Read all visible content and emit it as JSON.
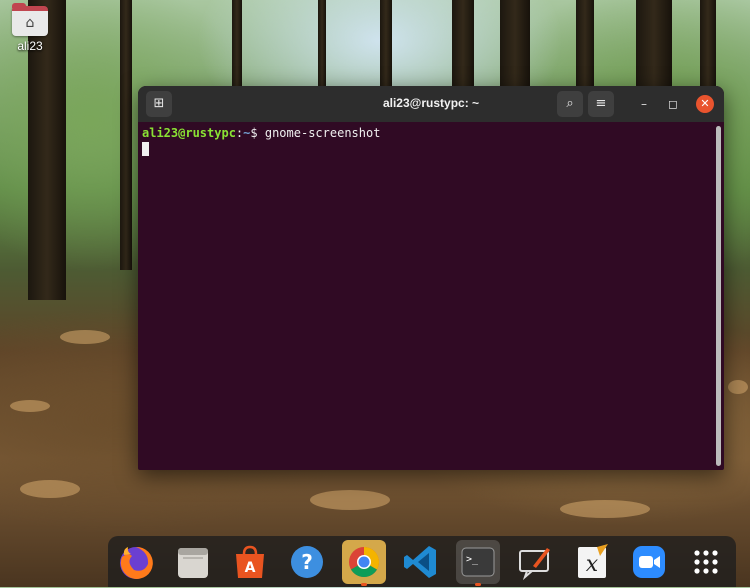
{
  "desktop": {
    "icons": [
      {
        "label": "ali23",
        "glyph": "⌂",
        "icon": "home-folder-icon"
      }
    ]
  },
  "terminal": {
    "title": "ali23@rustypc: ~",
    "buttons": {
      "new_tab_glyph": "⊞",
      "search_glyph": "⌕",
      "menu_glyph": "≡",
      "minimize_glyph": "–",
      "maximize_glyph": "◻",
      "close_glyph": "✕"
    },
    "prompt_user_host": "ali23@rustypc",
    "prompt_sep": ":",
    "prompt_path": "~",
    "prompt_symbol": "$",
    "command": "gnome-screenshot"
  },
  "dock": {
    "apps": [
      {
        "name": "Firefox",
        "icon": "firefox-icon"
      },
      {
        "name": "Files",
        "icon": "files-icon"
      },
      {
        "name": "Ubuntu Software",
        "icon": "software-center-icon"
      },
      {
        "name": "Help",
        "icon": "help-icon",
        "glyph": "?"
      },
      {
        "name": "Google Chrome",
        "icon": "chrome-icon",
        "active": true
      },
      {
        "name": "Visual Studio Code",
        "icon": "vscode-icon"
      },
      {
        "name": "Terminal",
        "icon": "terminal-icon",
        "active": true,
        "glyph": ">_"
      },
      {
        "name": "Screenshot Annotator",
        "icon": "annotate-icon"
      },
      {
        "name": "Xournal",
        "icon": "xournal-icon",
        "glyph": "x"
      },
      {
        "name": "Zoom",
        "icon": "zoom-icon"
      },
      {
        "name": "Show Applications",
        "icon": "app-grid-icon"
      }
    ],
    "colors": {
      "accent": "#e95420",
      "terminal_bg": "#300a24",
      "prompt_green": "#8ae234",
      "prompt_blue": "#729fcf"
    }
  }
}
